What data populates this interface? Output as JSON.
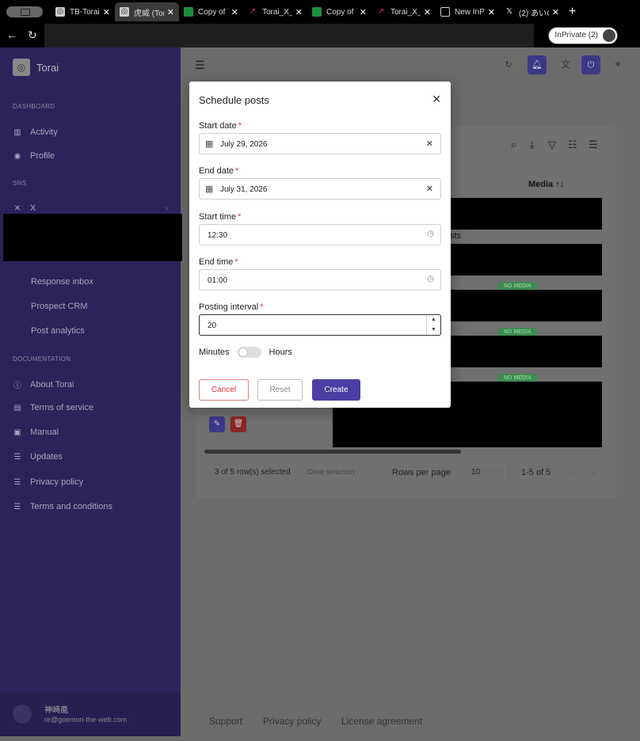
{
  "browser": {
    "tabs": [
      {
        "label": "TB-Torai",
        "active": false
      },
      {
        "label": "虎威 (Tor",
        "active": true
      },
      {
        "label": "Copy of T",
        "active": false
      },
      {
        "label": "Torai_X_",
        "active": false
      },
      {
        "label": "Copy of T",
        "active": false
      },
      {
        "label": "Torai_X_",
        "active": false
      },
      {
        "label": "New InPr",
        "active": false
      },
      {
        "label": "(2) あいの",
        "active": false
      }
    ],
    "inprivate_label": "InPrivate (2)"
  },
  "sidebar": {
    "brand": "Torai",
    "sections": {
      "dashboard": "DASHBOARD",
      "sns": "SNS",
      "documentation": "DOCUMENTATION"
    },
    "dashboard_items": [
      "Activity",
      "Profile"
    ],
    "sns_items": [
      "X"
    ],
    "sns_sub_items": [
      "Response inbox",
      "Prospect CRM",
      "Post analytics"
    ],
    "doc_items": [
      "About Torai",
      "Terms of service",
      "Manual",
      "Updates",
      "Privacy policy",
      "Terms and conditions"
    ],
    "user": {
      "name": "神崎凰",
      "email": "re@goemon-the-web.com"
    }
  },
  "table": {
    "col_media": "Media ↑↓",
    "row_text": "sts",
    "chips": [
      "NO MEDIA",
      "NO MEDIA",
      "NO MEDIA"
    ],
    "selected_text": "3 of 5 row(s) selected",
    "clear_selection": "Clear selection",
    "rows_per_page_label": "Rows per page",
    "rows_per_page_value": "10",
    "pagination": "1-5 of 5"
  },
  "footer": {
    "links": [
      "Support",
      "Privacy policy",
      "License agreement"
    ]
  },
  "modal": {
    "title": "Schedule posts",
    "start_date_label": "Start date",
    "start_date_value": "July 29, 2026",
    "end_date_label": "End date",
    "end_date_value": "July 31, 2026",
    "start_time_label": "Start time",
    "start_time_value": "12:30",
    "end_time_label": "End time",
    "end_time_value": "01:00",
    "interval_label": "Posting interval",
    "interval_value": "20",
    "unit_left": "Minutes",
    "unit_right": "Hours",
    "required_mark": "*",
    "cancel": "Cancel",
    "reset": "Reset",
    "create": "Create"
  }
}
